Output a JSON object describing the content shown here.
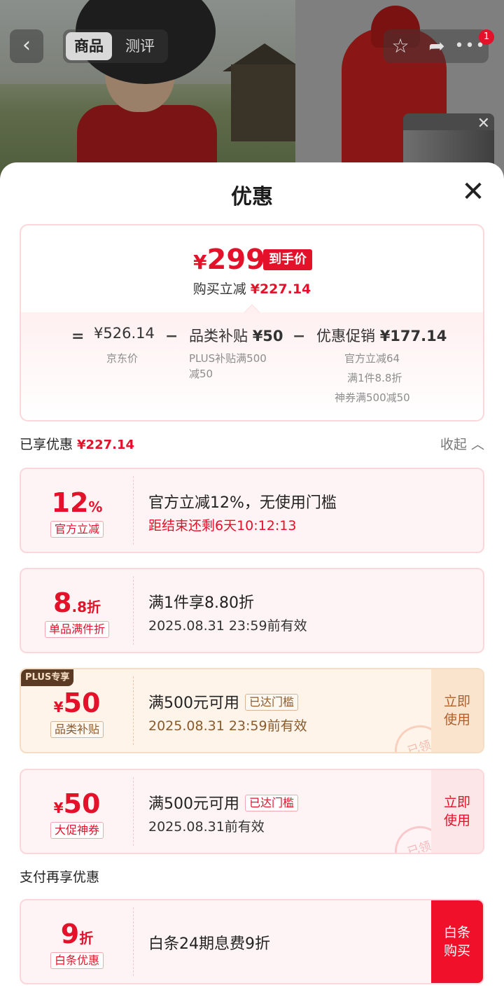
{
  "page_header": {
    "tab_active": "商品",
    "tab_inactive": "测评",
    "notification_count": "1"
  },
  "sheet": {
    "title": "优惠"
  },
  "price_summary": {
    "currency": "¥",
    "final_price": "299",
    "final_tag": "到手价",
    "instant_cut_label": "购买立减",
    "instant_cut_value": "¥227.14",
    "eq": "=",
    "minus": "−",
    "segments": [
      {
        "main": "¥526.14",
        "sub": [
          "京东价"
        ]
      },
      {
        "label": "品类补贴",
        "value": "¥50",
        "sub": [
          "PLUS补贴满500",
          "减50"
        ]
      },
      {
        "label": "优惠促销",
        "value": "¥177.14",
        "sub": [
          "官方立减64",
          "满1件8.8折",
          "神券满500减50"
        ]
      }
    ]
  },
  "enjoyed": {
    "label": "已享优惠",
    "value": "¥227.14",
    "collapse_label": "收起"
  },
  "coupons": [
    {
      "value_big": "12",
      "value_small": "%",
      "label": "官方立减",
      "title": "官方立减12%，无使用门槛",
      "subtitle": "距结束还剩6天10:12:13"
    },
    {
      "value_big": "8",
      "value_small": ".8折",
      "label": "单品满件折",
      "title": "满1件享8.80折",
      "subtitle": "2025.08.31 23:59前有效"
    },
    {
      "badge": "PLUS专享",
      "value_prefix": "¥",
      "value_big": "50",
      "label": "品类补贴",
      "title": "满500元可用",
      "tag": "已达门槛",
      "subtitle": "2025.08.31 23:59前有效",
      "action": "立即使用",
      "stamp": "已领"
    },
    {
      "value_prefix": "¥",
      "value_big": "50",
      "label": "大促神券",
      "title": "满500元可用",
      "tag": "已达门槛",
      "subtitle": "2025.08.31前有效",
      "action": "立即使用",
      "stamp": "已领"
    }
  ],
  "payment": {
    "section_label": "支付再享优惠",
    "value_big": "9",
    "value_small": "折",
    "label": "白条优惠",
    "title": "白条24期息费9折",
    "action": "白条购买"
  },
  "colors": {
    "accent_red": "#e3122a",
    "plus_badge_bg": "#5b3a24",
    "coupon_pink_bg": "#fff4f5",
    "coupon_gold_bg": "#fff4ea"
  }
}
